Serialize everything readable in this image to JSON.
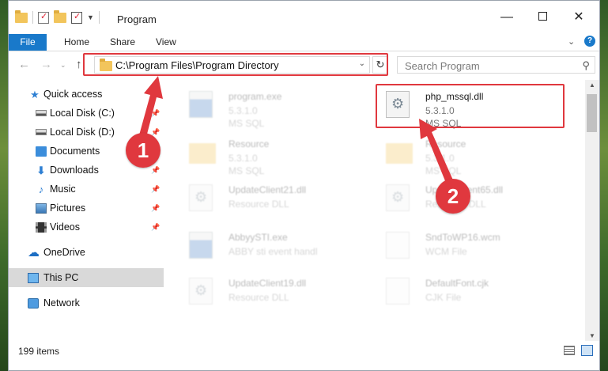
{
  "window": {
    "title": "Program",
    "controls": {
      "minimize": "—",
      "maximize": "",
      "close": "✕"
    }
  },
  "ribbon": {
    "tabs": [
      "File",
      "Home",
      "Share",
      "View"
    ],
    "help": "?",
    "collapse_chevron": "⌄"
  },
  "navigation": {
    "back": "←",
    "forward": "→",
    "recent": "⌄",
    "up": "↑",
    "address": "C:\\Program Files\\Program Directory",
    "address_dropdown": "⌄",
    "refresh": "↻",
    "search_placeholder": "Search Program",
    "search_glyph": "⚲"
  },
  "sidebar": {
    "items": [
      {
        "label": "Quick access",
        "icon": "star-icon"
      },
      {
        "label": "Local Disk (C:)",
        "icon": "drive-icon",
        "pinned": true
      },
      {
        "label": "Local Disk (D:)",
        "icon": "drive-icon",
        "pinned": true
      },
      {
        "label": "Documents",
        "icon": "documents-icon",
        "pinned": true
      },
      {
        "label": "Downloads",
        "icon": "download-icon",
        "pinned": true
      },
      {
        "label": "Music",
        "icon": "music-icon",
        "pinned": true
      },
      {
        "label": "Pictures",
        "icon": "pictures-icon",
        "pinned": true
      },
      {
        "label": "Videos",
        "icon": "videos-icon",
        "pinned": true
      },
      {
        "label": "OneDrive",
        "icon": "cloud-icon"
      },
      {
        "label": "This PC",
        "icon": "computer-icon",
        "selected": true
      },
      {
        "label": "Network",
        "icon": "network-icon"
      }
    ],
    "pin_glyph": "📌"
  },
  "files": [
    {
      "name": "program.exe",
      "line2": "5.3.1.0",
      "line3": "MS SQL",
      "icon": "exe-icon",
      "faded": true
    },
    {
      "name": "php_mssql.dll",
      "line2": "5.3.1.0",
      "line3": "MS SQL",
      "icon": "dll-gear-icon",
      "faded": false,
      "highlighted": true
    },
    {
      "name": "Resource",
      "line2": "5.3.1.0",
      "line3": "MS SQL",
      "icon": "folder-icon",
      "faded": true
    },
    {
      "name": "Resource",
      "line2": "5.3.1.0",
      "line3": "MS SQL",
      "icon": "folder-icon",
      "faded": true
    },
    {
      "name": "UpdateClient21.dll",
      "line2": "Resource DLL",
      "line3": "",
      "icon": "dll-gear-icon",
      "faded": true
    },
    {
      "name": "UpdateClient65.dll",
      "line2": "Resource DLL",
      "line3": "",
      "icon": "dll-gear-icon",
      "faded": true
    },
    {
      "name": "AbbyySTI.exe",
      "line2": "ABBY sti event handl",
      "line3": "",
      "icon": "exe-icon",
      "faded": true
    },
    {
      "name": "SndToWP16.wcm",
      "line2": "WCM File",
      "line3": "",
      "icon": "document-icon",
      "faded": true
    },
    {
      "name": "UpdateClient19.dll",
      "line2": "Resource DLL",
      "line3": "",
      "icon": "dll-gear-icon",
      "faded": true
    },
    {
      "name": "DefaultFont.cjk",
      "line2": "CJK File",
      "line3": "",
      "icon": "document-icon",
      "faded": true
    }
  ],
  "status": {
    "item_count": "199 items"
  },
  "annotations": {
    "marker_1": "1",
    "marker_2": "2",
    "color": "#e0383e"
  },
  "colors": {
    "accent": "#1979ca",
    "highlight": "#e0383e",
    "selection": "#d9d9d9"
  }
}
